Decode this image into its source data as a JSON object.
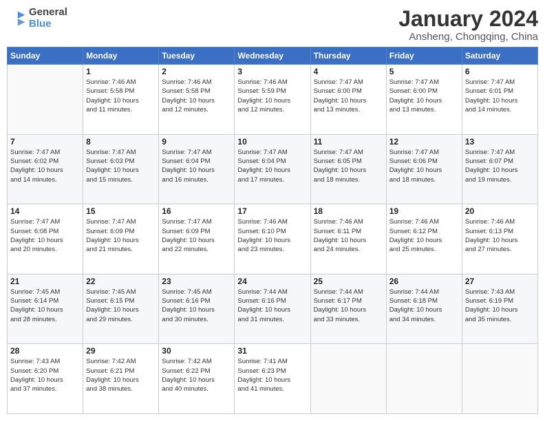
{
  "header": {
    "logo": {
      "general": "General",
      "blue": "Blue"
    },
    "title": "January 2024",
    "location": "Ansheng, Chongqing, China"
  },
  "days_header": [
    "Sunday",
    "Monday",
    "Tuesday",
    "Wednesday",
    "Thursday",
    "Friday",
    "Saturday"
  ],
  "weeks": [
    [
      {
        "day": "",
        "info": ""
      },
      {
        "day": "1",
        "info": "Sunrise: 7:46 AM\nSunset: 5:58 PM\nDaylight: 10 hours\nand 11 minutes."
      },
      {
        "day": "2",
        "info": "Sunrise: 7:46 AM\nSunset: 5:58 PM\nDaylight: 10 hours\nand 12 minutes."
      },
      {
        "day": "3",
        "info": "Sunrise: 7:46 AM\nSunset: 5:59 PM\nDaylight: 10 hours\nand 12 minutes."
      },
      {
        "day": "4",
        "info": "Sunrise: 7:47 AM\nSunset: 6:00 PM\nDaylight: 10 hours\nand 13 minutes."
      },
      {
        "day": "5",
        "info": "Sunrise: 7:47 AM\nSunset: 6:00 PM\nDaylight: 10 hours\nand 13 minutes."
      },
      {
        "day": "6",
        "info": "Sunrise: 7:47 AM\nSunset: 6:01 PM\nDaylight: 10 hours\nand 14 minutes."
      }
    ],
    [
      {
        "day": "7",
        "info": "Sunrise: 7:47 AM\nSunset: 6:02 PM\nDaylight: 10 hours\nand 14 minutes."
      },
      {
        "day": "8",
        "info": "Sunrise: 7:47 AM\nSunset: 6:03 PM\nDaylight: 10 hours\nand 15 minutes."
      },
      {
        "day": "9",
        "info": "Sunrise: 7:47 AM\nSunset: 6:04 PM\nDaylight: 10 hours\nand 16 minutes."
      },
      {
        "day": "10",
        "info": "Sunrise: 7:47 AM\nSunset: 6:04 PM\nDaylight: 10 hours\nand 17 minutes."
      },
      {
        "day": "11",
        "info": "Sunrise: 7:47 AM\nSunset: 6:05 PM\nDaylight: 10 hours\nand 18 minutes."
      },
      {
        "day": "12",
        "info": "Sunrise: 7:47 AM\nSunset: 6:06 PM\nDaylight: 10 hours\nand 18 minutes."
      },
      {
        "day": "13",
        "info": "Sunrise: 7:47 AM\nSunset: 6:07 PM\nDaylight: 10 hours\nand 19 minutes."
      }
    ],
    [
      {
        "day": "14",
        "info": "Sunrise: 7:47 AM\nSunset: 6:08 PM\nDaylight: 10 hours\nand 20 minutes."
      },
      {
        "day": "15",
        "info": "Sunrise: 7:47 AM\nSunset: 6:09 PM\nDaylight: 10 hours\nand 21 minutes."
      },
      {
        "day": "16",
        "info": "Sunrise: 7:47 AM\nSunset: 6:09 PM\nDaylight: 10 hours\nand 22 minutes."
      },
      {
        "day": "17",
        "info": "Sunrise: 7:46 AM\nSunset: 6:10 PM\nDaylight: 10 hours\nand 23 minutes."
      },
      {
        "day": "18",
        "info": "Sunrise: 7:46 AM\nSunset: 6:11 PM\nDaylight: 10 hours\nand 24 minutes."
      },
      {
        "day": "19",
        "info": "Sunrise: 7:46 AM\nSunset: 6:12 PM\nDaylight: 10 hours\nand 25 minutes."
      },
      {
        "day": "20",
        "info": "Sunrise: 7:46 AM\nSunset: 6:13 PM\nDaylight: 10 hours\nand 27 minutes."
      }
    ],
    [
      {
        "day": "21",
        "info": "Sunrise: 7:45 AM\nSunset: 6:14 PM\nDaylight: 10 hours\nand 28 minutes."
      },
      {
        "day": "22",
        "info": "Sunrise: 7:45 AM\nSunset: 6:15 PM\nDaylight: 10 hours\nand 29 minutes."
      },
      {
        "day": "23",
        "info": "Sunrise: 7:45 AM\nSunset: 6:16 PM\nDaylight: 10 hours\nand 30 minutes."
      },
      {
        "day": "24",
        "info": "Sunrise: 7:44 AM\nSunset: 6:16 PM\nDaylight: 10 hours\nand 31 minutes."
      },
      {
        "day": "25",
        "info": "Sunrise: 7:44 AM\nSunset: 6:17 PM\nDaylight: 10 hours\nand 33 minutes."
      },
      {
        "day": "26",
        "info": "Sunrise: 7:44 AM\nSunset: 6:18 PM\nDaylight: 10 hours\nand 34 minutes."
      },
      {
        "day": "27",
        "info": "Sunrise: 7:43 AM\nSunset: 6:19 PM\nDaylight: 10 hours\nand 35 minutes."
      }
    ],
    [
      {
        "day": "28",
        "info": "Sunrise: 7:43 AM\nSunset: 6:20 PM\nDaylight: 10 hours\nand 37 minutes."
      },
      {
        "day": "29",
        "info": "Sunrise: 7:42 AM\nSunset: 6:21 PM\nDaylight: 10 hours\nand 38 minutes."
      },
      {
        "day": "30",
        "info": "Sunrise: 7:42 AM\nSunset: 6:22 PM\nDaylight: 10 hours\nand 40 minutes."
      },
      {
        "day": "31",
        "info": "Sunrise: 7:41 AM\nSunset: 6:23 PM\nDaylight: 10 hours\nand 41 minutes."
      },
      {
        "day": "",
        "info": ""
      },
      {
        "day": "",
        "info": ""
      },
      {
        "day": "",
        "info": ""
      }
    ]
  ]
}
